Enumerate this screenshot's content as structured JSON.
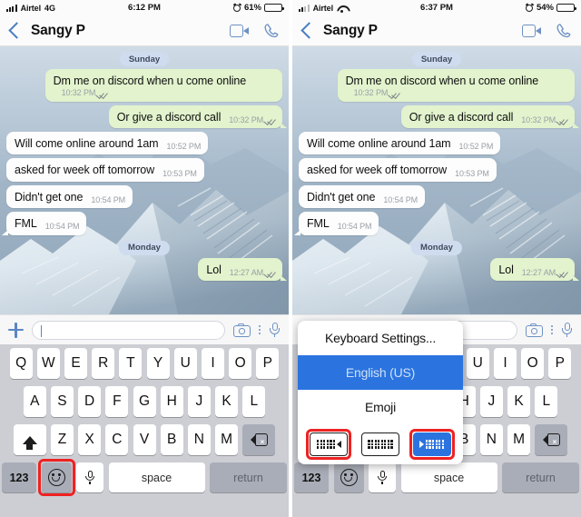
{
  "panels": [
    {
      "id": "left",
      "status": {
        "carrier": "Airtel",
        "network": "4G",
        "network_icon": "4g-text",
        "time": "6:12 PM",
        "battery_pct": "61%",
        "alarm_icon": "alarm-icon",
        "battery_icon": "battery-icon",
        "signal_icon": "signal-bars-icon"
      },
      "nav": {
        "back_icon": "back-chevron-icon",
        "title": "Sangy P",
        "video_icon": "video-call-icon",
        "call_icon": "phone-call-icon"
      },
      "input": {
        "plus_icon": "attach-plus-icon",
        "value": "",
        "placeholder": "",
        "camera_icon": "camera-icon",
        "more_icon": "more-vertical-icon",
        "mic_icon": "microphone-icon"
      },
      "popup_visible": false
    },
    {
      "id": "right",
      "status": {
        "carrier": "Airtel",
        "network": "",
        "network_icon": "wifi-icon",
        "time": "6:37 PM",
        "battery_pct": "54%",
        "alarm_icon": "alarm-icon",
        "battery_icon": "battery-icon",
        "signal_icon": "signal-bars-icon"
      },
      "nav": {
        "back_icon": "back-chevron-icon",
        "title": "Sangy P",
        "video_icon": "video-call-icon",
        "call_icon": "phone-call-icon"
      },
      "input": {
        "plus_icon": "attach-plus-icon",
        "value": "",
        "placeholder": "",
        "camera_icon": "camera-icon",
        "more_icon": "more-vertical-icon",
        "mic_icon": "microphone-icon"
      },
      "popup_visible": true
    }
  ],
  "conversation": {
    "day_1": "Sunday",
    "day_2": "Monday",
    "messages": [
      {
        "dir": "out",
        "text": "Dm me on discord when u come online",
        "time": "10:32 PM",
        "ticks": true
      },
      {
        "dir": "out",
        "text": "Or give a discord call",
        "time": "10:32 PM",
        "ticks": true
      },
      {
        "dir": "in",
        "text": "Will come online around 1am",
        "time": "10:52 PM",
        "ticks": false
      },
      {
        "dir": "in",
        "text": "asked for week off tomorrow",
        "time": "10:53 PM",
        "ticks": false
      },
      {
        "dir": "in",
        "text": "Didn't get one",
        "time": "10:54 PM",
        "ticks": false
      },
      {
        "dir": "in",
        "text": "FML",
        "time": "10:54 PM",
        "ticks": false
      },
      {
        "dir": "out",
        "text": "Lol",
        "time": "12:27 AM",
        "ticks": true
      }
    ]
  },
  "keyboard": {
    "row1": [
      "Q",
      "W",
      "E",
      "R",
      "T",
      "Y",
      "U",
      "I",
      "O",
      "P"
    ],
    "row2": [
      "A",
      "S",
      "D",
      "F",
      "G",
      "H",
      "J",
      "K",
      "L"
    ],
    "row3": [
      "Z",
      "X",
      "C",
      "V",
      "B",
      "N",
      "M"
    ],
    "shift_icon": "shift-arrow-icon",
    "delete_icon": "backspace-delete-icon",
    "num_label": "123",
    "emoji_icon": "emoji-smiley-icon",
    "mic_icon": "microphone-icon",
    "space_label": "space",
    "return_label": "return"
  },
  "popup": {
    "settings_label": "Keyboard Settings...",
    "language_label": "English (US)",
    "emoji_label": "Emoji",
    "layout_icons": [
      {
        "name": "keyboard-dock-left-icon",
        "selected": false,
        "highlighted": true
      },
      {
        "name": "keyboard-dock-full-icon",
        "selected": false,
        "highlighted": false
      },
      {
        "name": "keyboard-dock-right-icon",
        "selected": true,
        "highlighted": true
      }
    ]
  },
  "colors": {
    "outgoing_bubble": "#e2f3cd",
    "incoming_bubble": "#fdfdfd",
    "day_pill": "#cfdcef",
    "accent_blue": "#2b74e0",
    "icon_blue": "#6d92c4",
    "highlight_red": "#ee2222",
    "keyboard_bg": "#ccced4"
  }
}
